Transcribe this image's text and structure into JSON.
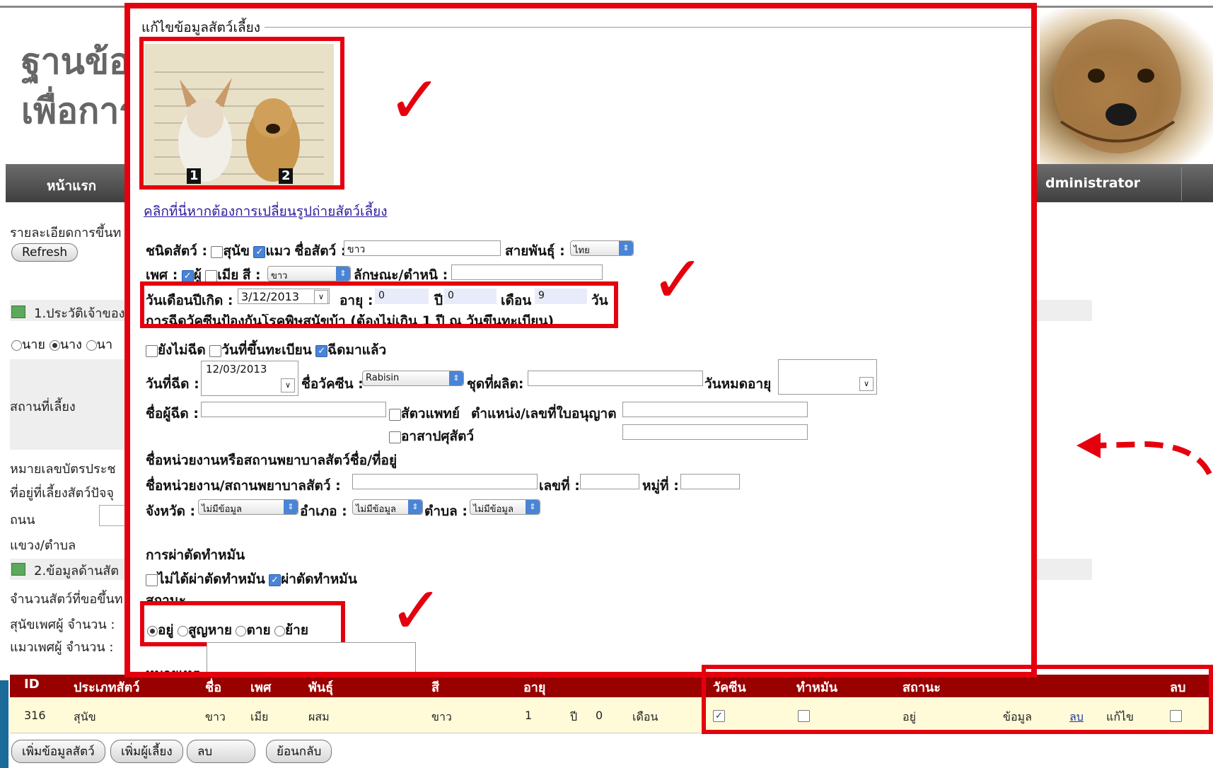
{
  "header": {
    "title_line1": "ฐานข้อมู",
    "title_line2": "เพื่อการ"
  },
  "nav": {
    "home": "หน้าแรก",
    "admin": "dministrator"
  },
  "left_panel": {
    "details_label": "รายละเอียดการขึ้นท",
    "refresh_button": "Refresh",
    "section1": "1.ประวัติเจ้าของ",
    "title_options": [
      "นาย",
      "นาง",
      "นา"
    ],
    "location_label": "สถานที่เลี้ยง",
    "id_card_label": "หมายเลขบัตรประช",
    "address_label": "ที่อยู่ที่เลี้ยงสัตว์ปัจจุ",
    "road_label": "ถนน",
    "subdistrict_label": "แขวง/ตำบล",
    "section2": "2.ข้อมูลด้านสัต",
    "count_label": "จำนวนสัตว์ที่ขอขึ้นท",
    "male_dogs_label": "สุนัขเพศผู้ จำนวน :",
    "male_cats_label": "แมวเพศผู้ จำนวน :"
  },
  "table": {
    "headers": [
      "ID",
      "ประเภทสัตว์",
      "ชื่อ",
      "เพศ",
      "พันธุ์",
      "สี",
      "อายุ",
      "วัคซีน",
      "ทำหมัน",
      "สถานะ",
      "ลบ"
    ],
    "row": {
      "id": "316",
      "type": "สุนัข",
      "name": "ขาว",
      "sex": "เมีย",
      "breed": "ผสม",
      "color": "ขาว",
      "age_years": "1",
      "years_unit": "ปี",
      "age_months": "0",
      "months_unit": "เดือน",
      "status": "อยู่",
      "info_link": "ข้อมูล",
      "delete_link": "ลบ",
      "edit_link": "แก้ไข"
    }
  },
  "bottom_buttons": [
    "เพิ่มข้อมูลสัตว์",
    "เพิ่มผู้เลี้ยง",
    "ลบ",
    "ย้อนกลับ"
  ],
  "dialog": {
    "legend": "แก้ไขข้อมูลสัตว์เลี้ยง",
    "change_photo_link": "คลิกที่นี่หากต้องการเปลี่ยนรูปถ่ายสัตว์เลี้ยง",
    "animal_type_label": "ชนิดสัตว์ :",
    "dog": "สุนัข",
    "cat": "แมว",
    "pet_name_label": "ชื่อสัตว์ :",
    "pet_name_value": "ขาว",
    "breed_label": "สายพันธุ์ :",
    "breed_value": "ไทย",
    "sex_label": "เพศ :",
    "male": "ผู้",
    "female": "เมีย",
    "color_label": "สี :",
    "color_value": "ขาว",
    "markings_label": "ลักษณะ/ตำหนิ :",
    "birthdate_label": "วันเดือนปีเกิด :",
    "birthdate_value": "3/12/2013",
    "age_label": "อายุ :",
    "age_years_value": "0",
    "years_unit": "ปี",
    "age_months_value": "0",
    "months_unit": "เดือน",
    "age_days_value": "9",
    "days_unit": "วัน",
    "rabies_heading": "การฉีดวัคซีนป้องกันโรคพิษสุนัขบ้า (ต้องไม่เกิน 1 ปี ณ วันขึ้นทะเบียน)",
    "not_vaccinated": "ยังไม่ฉีด",
    "on_registration_day": "วันที่ขึ้นทะเบียน",
    "already_vaccinated": "ฉีดมาแล้ว",
    "vaccine_date_label": "วันที่ฉีด :",
    "vaccine_date_value": "12/03/2013",
    "vaccine_name_label": "ชื่อวัคซีน :",
    "vaccine_name_value": "Rabisin",
    "lot_label": "ชุดที่ผลิต:",
    "expiry_label": "วันหมดอายุ",
    "injector_label": "ชื่อผู้ฉีด :",
    "vet": "สัตวแพทย์",
    "position_label": "ตำแหน่ง/เลขที่ใบอนุญาต",
    "volunteer": "อาสาปศุสัตว์",
    "unit_heading": "ชื่อหน่วยงานหรือสถานพยาบาลสัตว์ชื่อ/ที่อยู่",
    "unit_name_label": "ชื่อหน่วยงาน/สถานพยาบาลสัตว์ :",
    "house_no_label": "เลขที่ :",
    "village_label": "หมู่ที่ :",
    "province_label": "จังหวัด :",
    "province_value": "ไม่มีข้อมูล",
    "district_label": "อำเภอ :",
    "district_value": "ไม่มีข้อมูล",
    "subdistrict_label": "ตำบล :",
    "subdistrict_value": "ไม่มีข้อมูล",
    "neuter_heading": "การผ่าตัดทำหมัน",
    "not_neutered": "ไม่ได้ผ่าตัดทำหมัน",
    "neutered": "ผ่าตัดทำหมัน",
    "status_heading": "สถานะ",
    "status_options": [
      "อยู่",
      "สูญหาย",
      "ตาย",
      "ย้าย"
    ],
    "note_label": "หมายเหตุ"
  },
  "photo": {
    "badge1": "1",
    "badge2": "2"
  },
  "icons": {
    "check": "✓",
    "arrow": "←"
  },
  "colors": {
    "annotation_red": "#e5000e",
    "table_header": "#990000",
    "nav_dark": "#3f3f3f",
    "row_yellow": "#fffbd9"
  }
}
